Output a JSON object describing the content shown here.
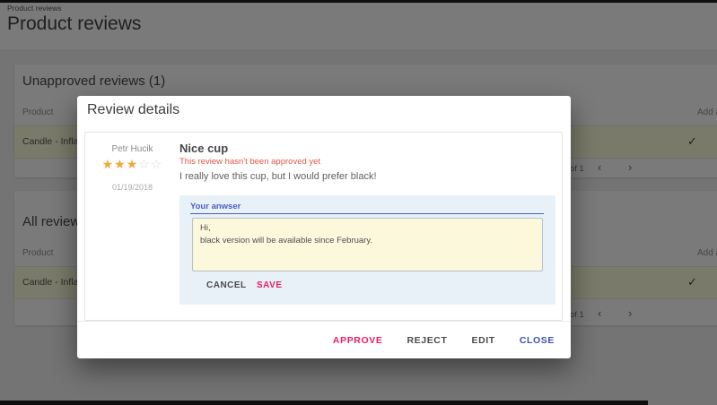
{
  "page": {
    "breadcrumb": "Product reviews",
    "title": "Product reviews",
    "unapproved_card": {
      "title": "Unapproved reviews (1)",
      "col_product": "Product",
      "col_answer": "Add answer",
      "row": {
        "product": "Candle - Inflamm",
        "check": "✓"
      },
      "pagination": {
        "of": "of 1",
        "prev": "‹",
        "next": "›"
      }
    },
    "all_card": {
      "title": "All reviews",
      "col_product": "Product",
      "col_answer": "Add answer",
      "row": {
        "product": "Candle - Inflamm",
        "check": "✓"
      },
      "pagination": {
        "of": "of 1",
        "prev": "‹",
        "next": "›"
      }
    }
  },
  "modal": {
    "title": "Review details",
    "review": {
      "author": "Petr Hucik",
      "rating": 3,
      "rating_max": 5,
      "stars_filled": "★★★",
      "stars_empty": "☆☆",
      "date": "01/19/2018",
      "title": "Nice cup",
      "status_note": "This review hasn't been approved yet",
      "body": "I really love this cup, but I would prefer black!"
    },
    "answer": {
      "label": "Your anwser",
      "value": "Hi,\nblack version will be available since February.",
      "cancel": "CANCEL",
      "save": "SAVE"
    },
    "actions": {
      "approve": "APPROVE",
      "reject": "REJECT",
      "edit": "EDIT",
      "close": "CLOSE"
    }
  },
  "colors": {
    "accent_pink": "#e91e63",
    "accent_blue": "#3f51b5",
    "star_orange": "#f3a63a",
    "row_highlight": "#ffffdd",
    "note_red": "#e2574c",
    "answer_panel_bg": "#e9f1f8",
    "textarea_bg": "#fcf8dc"
  }
}
